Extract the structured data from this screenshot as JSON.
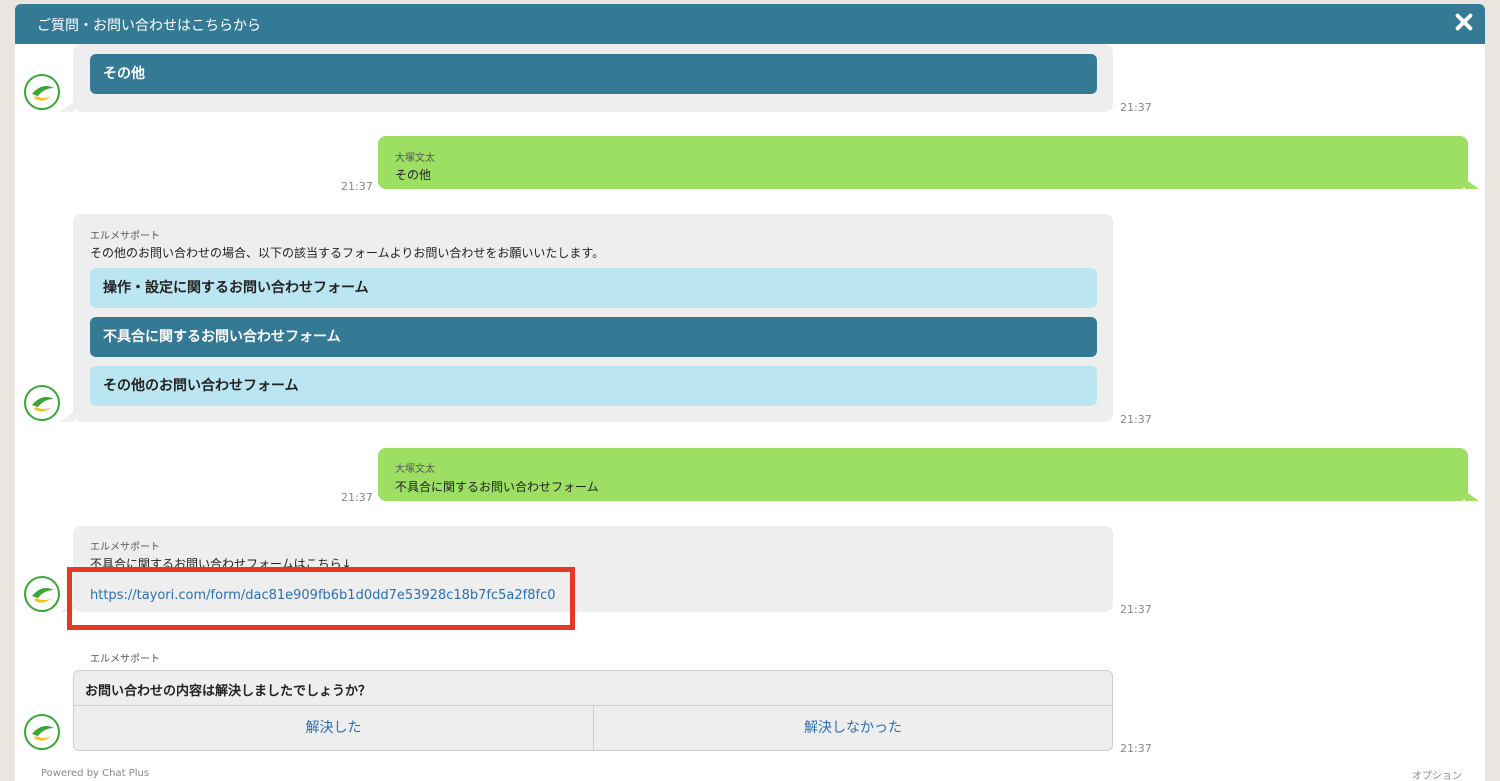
{
  "header": {
    "title": "ご質問・お問い合わせはこちらから"
  },
  "messages": {
    "m1": {
      "button_label": "その他",
      "time": "21:37"
    },
    "m2": {
      "sender": "大塚文太",
      "text": "その他",
      "time": "21:37"
    },
    "m3": {
      "sender": "エルメサポート",
      "text": "その他のお問い合わせの場合、以下の該当するフォームよりお問い合わせをお願いいたします。",
      "buttons": [
        "操作・設定に関するお問い合わせフォーム",
        "不具合に関するお問い合わせフォーム",
        "その他のお問い合わせフォーム"
      ],
      "time": "21:37"
    },
    "m4": {
      "sender": "大塚文太",
      "text": "不具合に関するお問い合わせフォーム",
      "time": "21:37"
    },
    "m5": {
      "sender": "エルメサポート",
      "text": "不具合に関するお問い合わせフォームはこちら↓",
      "link": "https://tayori.com/form/dac81e909fb6b1d0dd7e53928c18b7fc5a2f8fc0",
      "time": "21:37"
    },
    "m6": {
      "sender": "エルメサポート",
      "question": "お問い合わせの内容は解決しましたでしょうか？",
      "yes_label": "解決した",
      "no_label": "解決しなかった",
      "time": "21:37"
    }
  },
  "footer": {
    "powered_by": "Powered by Chat Plus",
    "options": "オプション"
  },
  "colors": {
    "header": "#347a95",
    "incoming_bubble": "#eeeeee",
    "outgoing_bubble": "#9cdf62",
    "button_dark": "#347a95",
    "button_light": "#bce5f2",
    "link": "#2a6fb5",
    "highlight": "#e43a24"
  }
}
